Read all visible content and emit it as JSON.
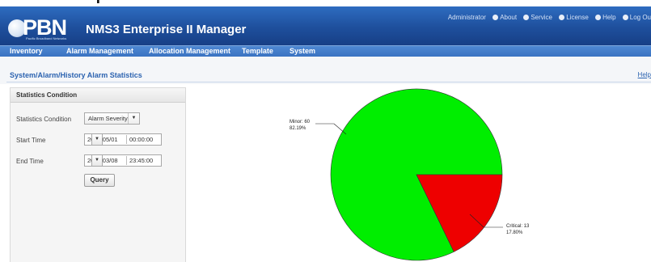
{
  "header": {
    "logo_text": "PBN",
    "logo_subtext": "Pacific Broadband Networks",
    "app_title": "NMS3 Enterprise II Manager",
    "top_links": [
      "Administrator",
      "About",
      "Service",
      "License",
      "Help",
      "Log Ou"
    ]
  },
  "nav": {
    "items": [
      "Inventory",
      "Alarm Management",
      "Allocation Management",
      "Template",
      "System"
    ]
  },
  "page": {
    "breadcrumb": "System/Alarm/History Alarm Statistics",
    "help": "Help"
  },
  "panel": {
    "title": "Statistics Condition",
    "condition_label": "Statistics Condition",
    "condition_value": "Alarm Severity",
    "start_label": "Start Time",
    "start_date": "2012/05/01",
    "start_time": "00:00:00",
    "end_label": "End Time",
    "end_date": "2013/03/08",
    "end_time": "23:45:00",
    "query_label": "Query"
  },
  "chart_data": {
    "type": "pie",
    "slices": [
      {
        "label": "Minor",
        "value": 60,
        "percent": "82.19%",
        "color": "#00ee00"
      },
      {
        "label": "Critical",
        "value": 13,
        "percent": "17.80%",
        "color": "#ee0000"
      }
    ],
    "label_texts": {
      "minor_line1": "Minor: 60",
      "minor_line2": "82.19%",
      "critical_line1": "Critical: 13",
      "critical_line2": "17.80%"
    }
  }
}
